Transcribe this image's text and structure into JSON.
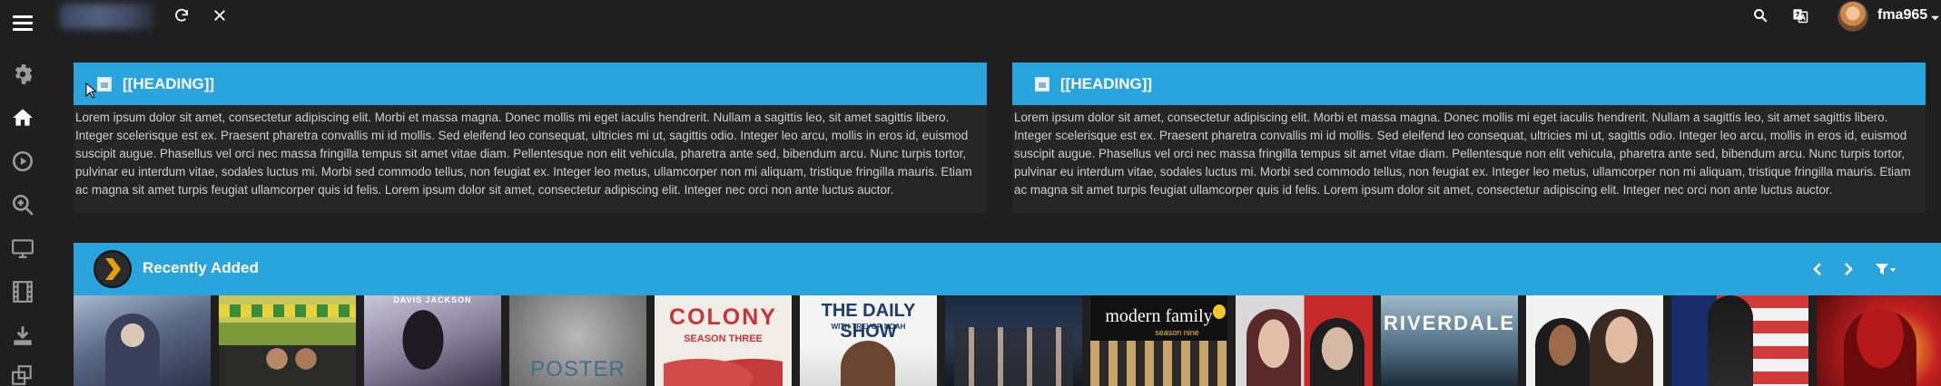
{
  "header": {
    "username": "fma965",
    "icons": [
      "menu-icon",
      "refresh-icon",
      "close-icon",
      "search-icon",
      "translate-icon"
    ]
  },
  "sidebar": {
    "items": [
      "gear-icon",
      "home-icon",
      "play-icon",
      "zoom-icon",
      "monitor-icon",
      "film-icon",
      "download-icon",
      "layers-icon"
    ]
  },
  "panels": [
    {
      "title": "[[HEADING]]",
      "body": "Lorem ipsum dolor sit amet, consectetur adipiscing elit. Morbi et massa magna. Donec mollis mi eget iaculis hendrerit. Nullam a sagittis leo, sit amet sagittis libero. Integer scelerisque est ex. Praesent pharetra convallis mi id mollis. Sed eleifend leo consequat, ultricies mi ut, sagittis odio. Integer leo arcu, mollis in eros id, euismod suscipit augue. Phasellus vel orci nec massa fringilla tempus sit amet vitae diam. Pellentesque non elit vehicula, pharetra ante sed, bibendum arcu. Nunc turpis tortor, pulvinar eu interdum vitae, sodales luctus mi. Morbi sed commodo tellus, non feugiat ex. Integer leo metus, ullamcorper non mi aliquam, tristique fringilla mauris. Etiam ac magna sit amet turpis feugiat ullamcorper quis id felis. Lorem ipsum dolor sit amet, consectetur adipiscing elit. Integer nec orci non ante luctus auctor."
    },
    {
      "title": "[[HEADING]]",
      "body": "Lorem ipsum dolor sit amet, consectetur adipiscing elit. Morbi et massa magna. Donec mollis mi eget iaculis hendrerit. Nullam a sagittis leo, sit amet sagittis libero. Integer scelerisque est ex. Praesent pharetra convallis mi id mollis. Sed eleifend leo consequat, ultricies mi ut, sagittis odio. Integer leo arcu, mollis in eros id, euismod suscipit augue. Phasellus vel orci nec massa fringilla tempus sit amet vitae diam. Pellentesque non elit vehicula, pharetra ante sed, bibendum arcu. Nunc turpis tortor, pulvinar eu interdum vitae, sodales luctus mi. Morbi sed commodo tellus, non feugiat ex. Integer leo metus, ullamcorper non mi aliquam, tristique fringilla mauris. Etiam ac magna sit amet turpis feugiat ullamcorper quis id felis. Lorem ipsum dolor sit amet, consectetur adipiscing elit. Integer nec orci non ante luctus auctor."
    }
  ],
  "recent": {
    "title": "Recently Added",
    "posters": [
      {
        "text": "",
        "sub": ""
      },
      {
        "text": "",
        "sub": ""
      },
      {
        "text": "DAVIS   JACKSON",
        "sub": ""
      },
      {
        "text": "POSTER",
        "sub": ""
      },
      {
        "text": "COLONY",
        "sub": "SEASON THREE"
      },
      {
        "text": "THE DAILY SHOW",
        "sub": "WITH TREVOR NOAH"
      },
      {
        "text": "",
        "sub": ""
      },
      {
        "text": "modern family",
        "sub": "season nine"
      },
      {
        "text": "",
        "sub": ""
      },
      {
        "text": "RIVERDALE",
        "sub": ""
      },
      {
        "text": "",
        "sub": ""
      },
      {
        "text": "",
        "sub": ""
      },
      {
        "text": "",
        "sub": ""
      }
    ]
  },
  "colors": {
    "accent": "#2aa4dd",
    "background": "#1f1f1f",
    "panel": "#262626"
  }
}
